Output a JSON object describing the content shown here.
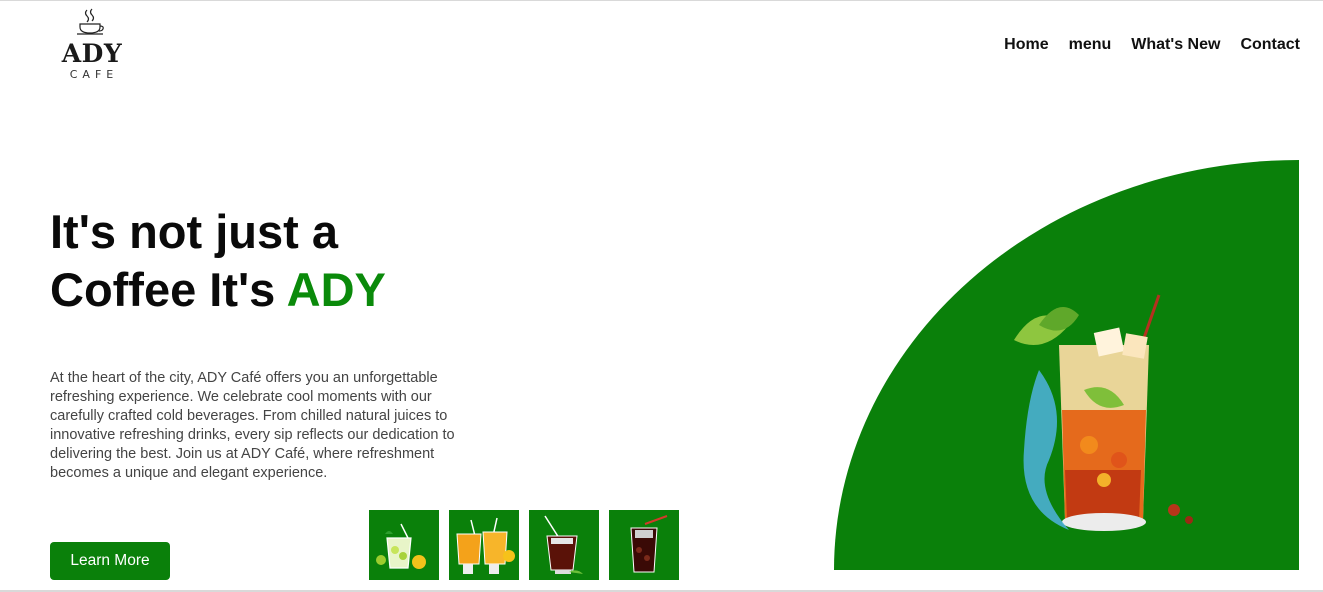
{
  "logo": {
    "name": "ADY",
    "sub": "CAFE"
  },
  "nav": [
    {
      "label": "Home"
    },
    {
      "label": "menu"
    },
    {
      "label": "What's New"
    },
    {
      "label": "Contact"
    }
  ],
  "hero": {
    "headline_line1": "It's not just a",
    "headline_line2": "Coffee It's",
    "headline_accent": "ADY",
    "description": "At the heart of the city, ADY Café offers you an unforgettable refreshing experience. We celebrate cool moments with our carefully crafted cold beverages. From chilled natural juices to innovative refreshing drinks, every sip reflects our dedication to delivering the best. Join us at ADY Café, where refreshment becomes a unique and elegant experience.",
    "cta_label": "Learn More"
  },
  "thumbnails": [
    {
      "icon": "lemonade-icon"
    },
    {
      "icon": "orange-juice-icon"
    },
    {
      "icon": "cola-glass-icon"
    },
    {
      "icon": "iced-cola-icon"
    }
  ],
  "colors": {
    "brand_green": "#0a800a",
    "accent_text": "#0a8a0a"
  }
}
